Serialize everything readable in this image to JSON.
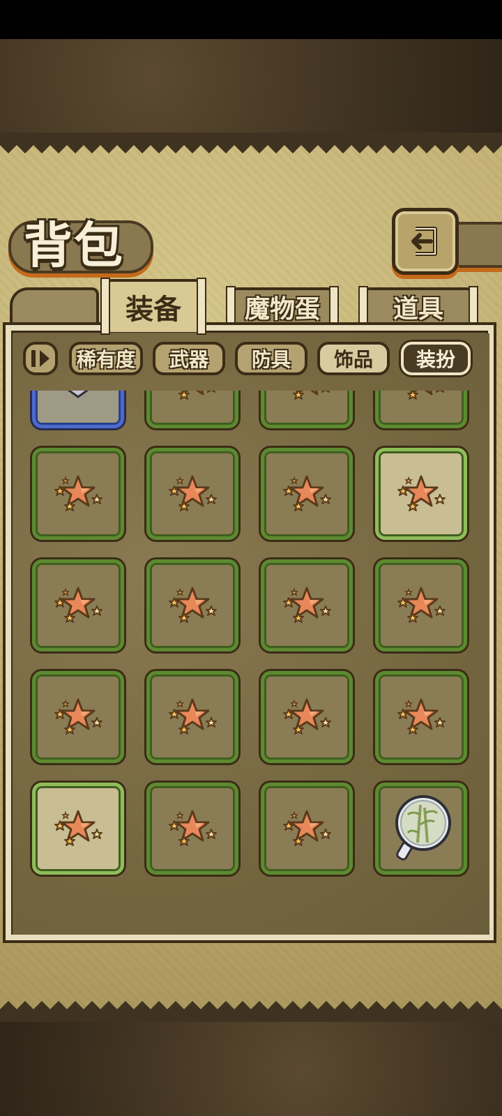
{
  "title": "背包",
  "tabs": [
    {
      "label": "装备",
      "active": true
    },
    {
      "label": "魔物蛋",
      "active": false
    },
    {
      "label": "道具",
      "active": false
    }
  ],
  "filters": {
    "sort_icon": "pause-play-icon",
    "items": [
      {
        "label": "稀有度",
        "style": "normal"
      },
      {
        "label": "武器",
        "style": "normal"
      },
      {
        "label": "防具",
        "style": "normal"
      },
      {
        "label": "饰品",
        "style": "light"
      },
      {
        "label": "装扮",
        "style": "dark"
      }
    ]
  },
  "back_icon": "return-arrow-icon",
  "inventory": {
    "rows": [
      [
        {
          "icon": "bat-helmet-icon",
          "rarity": "blue"
        },
        {
          "icon": "stars-icon",
          "rarity": "green"
        },
        {
          "icon": "stars-icon",
          "rarity": "green"
        },
        {
          "icon": "stars-icon",
          "rarity": "green"
        }
      ],
      [
        {
          "icon": "stars-icon",
          "rarity": "green"
        },
        {
          "icon": "stars-icon",
          "rarity": "green"
        },
        {
          "icon": "stars-icon",
          "rarity": "green"
        },
        {
          "icon": "stars-icon",
          "rarity": "light"
        }
      ],
      [
        {
          "icon": "stars-icon",
          "rarity": "green"
        },
        {
          "icon": "stars-icon",
          "rarity": "green"
        },
        {
          "icon": "stars-icon",
          "rarity": "green"
        },
        {
          "icon": "stars-icon",
          "rarity": "green"
        }
      ],
      [
        {
          "icon": "stars-icon",
          "rarity": "green"
        },
        {
          "icon": "stars-icon",
          "rarity": "green"
        },
        {
          "icon": "stars-icon",
          "rarity": "green"
        },
        {
          "icon": "stars-icon",
          "rarity": "green"
        }
      ],
      [
        {
          "icon": "stars-icon",
          "rarity": "light"
        },
        {
          "icon": "stars-icon",
          "rarity": "green"
        },
        {
          "icon": "stars-icon",
          "rarity": "green"
        },
        {
          "icon": "bamboo-mirror-icon",
          "rarity": "green"
        }
      ]
    ]
  },
  "colors": {
    "parchment": "#c4b276",
    "frame": "#3b2c16",
    "green_rarity": "#5d8a30",
    "blue_rarity": "#4a6ad0",
    "accent_orange": "#c46a1a"
  }
}
